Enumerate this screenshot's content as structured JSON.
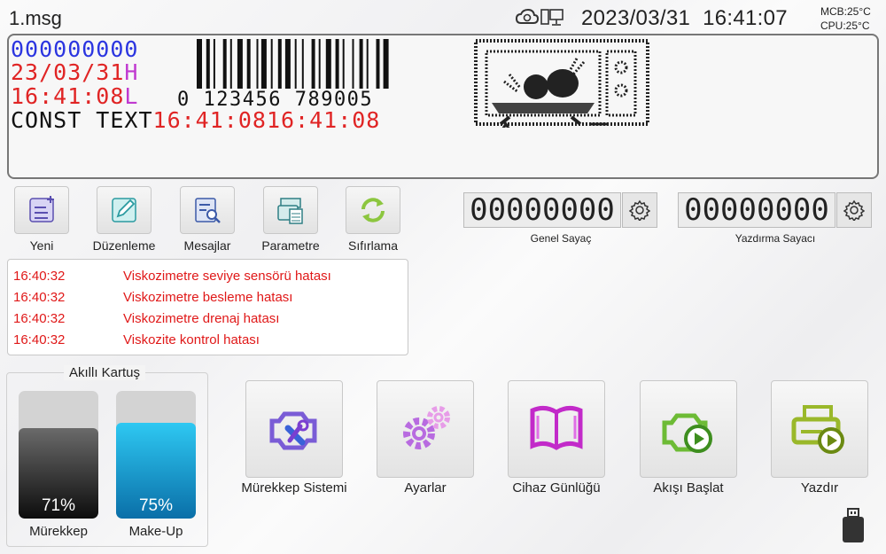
{
  "header": {
    "filename": "1.msg",
    "date": "2023/03/31",
    "time": "16:41:07",
    "mcb_temp": "MCB:25°C",
    "cpu_temp": "CPU:25°C",
    "icons": [
      "cloud-sync-icon",
      "computer-icon"
    ]
  },
  "preview": {
    "counter": "000000000",
    "date": "23/03/31",
    "date_suffix": "H",
    "time": "16:41:08",
    "time_suffix": "L",
    "const_text": "CONST TEXT",
    "time_repeat_1": "16:41:08",
    "time_repeat_2": "16:41:08",
    "barcode_digits": "0 123456 789005",
    "colors": {
      "counter": "#2b35e0",
      "date_time": "#e02424",
      "suffix": "#c03ad0",
      "text": "#111111"
    }
  },
  "toolbar": {
    "items": [
      {
        "label": "Yeni",
        "icon": "new-file-icon"
      },
      {
        "label": "Düzenleme",
        "icon": "edit-icon"
      },
      {
        "label": "Mesajlar",
        "icon": "messages-search-icon"
      },
      {
        "label": "Parametre",
        "icon": "parameters-icon"
      },
      {
        "label": "Sıfırlama",
        "icon": "reset-icon"
      }
    ]
  },
  "counters": {
    "general": {
      "value": "00000000",
      "label": "Genel Sayaç"
    },
    "print": {
      "value": "00000000",
      "label": "Yazdırma Sayacı"
    }
  },
  "alarms": [
    {
      "time": "16:40:32",
      "message": "Viskozimetre seviye sensörü hatası"
    },
    {
      "time": "16:40:32",
      "message": "Viskozimetre besleme hatası"
    },
    {
      "time": "16:40:32",
      "message": "Viskozimetre drenaj hatası"
    },
    {
      "time": "16:40:32",
      "message": "Viskozite kontrol hatası"
    }
  ],
  "smart_card": {
    "title": "Akıllı Kartuş",
    "ink": {
      "label": "Mürekkep",
      "percent_text": "71%",
      "level": 0.71
    },
    "makeup": {
      "label": "Make-Up",
      "percent_text": "75%",
      "level": 0.75
    }
  },
  "actions": [
    {
      "label": "Mürekkep Sistemi",
      "icon": "ink-system-icon"
    },
    {
      "label": "Ayarlar",
      "icon": "settings-gears-icon"
    },
    {
      "label": "Cihaz Günlüğü",
      "icon": "device-log-book-icon"
    },
    {
      "label": "Akışı Başlat",
      "icon": "start-flow-icon"
    },
    {
      "label": "Yazdır",
      "icon": "print-start-icon"
    }
  ],
  "status": {
    "icon": "usb-drive-icon"
  }
}
